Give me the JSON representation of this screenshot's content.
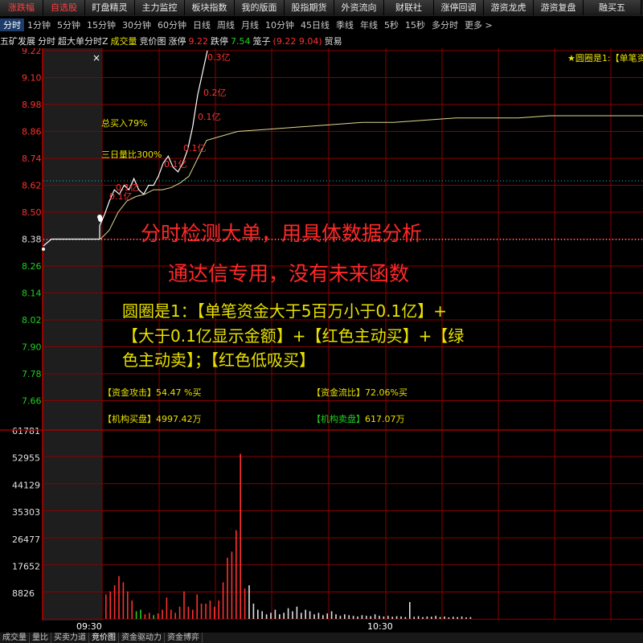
{
  "top_tabs": [
    {
      "label": "涨跌幅",
      "active": true,
      "w": 54
    },
    {
      "label": "自选股",
      "active": true,
      "w": 52
    },
    {
      "label": "盯盘精灵",
      "w": 62
    },
    {
      "label": "主力监控",
      "w": 62
    },
    {
      "label": "板块指数",
      "w": 62
    },
    {
      "label": "我的版面",
      "w": 62
    },
    {
      "label": "股指期货",
      "w": 62
    },
    {
      "label": "外资流向",
      "w": 62
    },
    {
      "label": "财联社",
      "w": 62
    },
    {
      "label": "涨停回调",
      "w": 62
    },
    {
      "label": "游资龙虎",
      "w": 62
    },
    {
      "label": "游资复盘",
      "w": 62
    },
    {
      "label": "融买五",
      "w": 72
    }
  ],
  "periods": [
    "分时",
    "1分钟",
    "5分钟",
    "15分钟",
    "30分钟",
    "60分钟",
    "日线",
    "周线",
    "月线",
    "10分钟",
    "45日线",
    "季线",
    "年线",
    "5秒",
    "15秒",
    "多分时",
    "更多 >"
  ],
  "stock": {
    "name": "五矿发展",
    "mode": "分时",
    "indicator": "超大单分时Z",
    "vol_label": "成交量",
    "pricechart_label": "竞价图",
    "limit_up_label": "涨停",
    "limit_up": "9.22",
    "limit_down_label": "跌停",
    "limit_down": "7.54",
    "cage_label": "笼子",
    "cage_value": "(9.22 9.04)",
    "trade": "贸易"
  },
  "corner_label": "★圆圈是1:【单笔资",
  "close_symbol": "×",
  "price_axis": [
    "9.22",
    "9.10",
    "8.98",
    "8.86",
    "8.74",
    "8.62",
    "8.50",
    "8.38",
    "8.26",
    "8.14",
    "8.02",
    "7.90",
    "7.78",
    "7.66"
  ],
  "volume_axis": [
    "61781",
    "52955",
    "44129",
    "35303",
    "26477",
    "17652",
    "8826"
  ],
  "time_labels": [
    "09:30",
    "10:30"
  ],
  "annotations": {
    "total_buy": "总买入79%",
    "three_day_ratio": "三日量比300%",
    "big_orders": [
      "0.3亿",
      "0.2亿",
      "0.1亿",
      "0.1亿",
      "0.1亿",
      "0.1亿",
      "0.1亿"
    ]
  },
  "overlay": {
    "line1": "分时检测大单，用具体数据分析",
    "line2": "通达信专用，没有未来函数",
    "desc": [
      "圆圈是1：【单笔资金大于5百万小于0.1亿】+",
      "【大于0.1亿显示金额】+【红色主动买】+【绿",
      "色主动卖】；【红色低吸买】"
    ]
  },
  "stats": {
    "attack_label": "【资金攻击】",
    "attack_value": "54.47 %买",
    "flow_label": "【资金流比】",
    "flow_value": "72.06%买",
    "inst_buy_label": "【机构买盘】",
    "inst_buy_value": "4997.42万",
    "inst_sell_label": "【机构卖盘】",
    "inst_sell_value": "617.07万"
  },
  "bottom_tabs": [
    "成交量",
    "量比",
    "买卖力道",
    "竞价图",
    "资金驱动力",
    "资金博弈"
  ],
  "colors": {
    "up": "#ff3030",
    "down": "#20d020",
    "accent": "#e8e000",
    "grid": "#8a0000"
  },
  "chart_data": {
    "type": "line",
    "x_labels": [
      "09:30",
      "10:30"
    ],
    "ylim": [
      7.6,
      9.22
    ],
    "price_series": [
      8.35,
      8.38,
      8.38,
      8.38,
      8.38,
      8.38,
      8.38,
      8.38,
      8.44,
      8.49,
      8.55,
      8.6,
      8.58,
      8.62,
      8.6,
      8.65,
      8.6,
      8.58,
      8.62,
      8.62,
      8.66,
      8.72,
      8.75,
      8.7,
      8.68,
      8.72,
      8.78,
      8.88,
      9.02,
      9.12,
      9.22
    ],
    "avg_series": [
      8.38,
      8.42,
      8.5,
      8.55,
      8.57,
      8.58,
      8.6,
      8.6,
      8.61,
      8.63,
      8.66,
      8.74,
      8.82,
      8.86,
      8.87,
      8.88,
      8.89,
      8.9,
      8.9,
      8.91,
      8.92,
      8.92,
      8.92,
      8.93,
      8.93,
      8.93,
      8.93
    ],
    "volume_ylim": [
      0,
      61781
    ],
    "volume_bars": [
      {
        "v": 8000,
        "c": "up"
      },
      {
        "v": 9000,
        "c": "up"
      },
      {
        "v": 11000,
        "c": "up"
      },
      {
        "v": 14000,
        "c": "up"
      },
      {
        "v": 12000,
        "c": "up"
      },
      {
        "v": 9000,
        "c": "up"
      },
      {
        "v": 6000,
        "c": "up"
      },
      {
        "v": 2500,
        "c": "down"
      },
      {
        "v": 3000,
        "c": "down"
      },
      {
        "v": 1500,
        "c": "up"
      },
      {
        "v": 2000,
        "c": "up"
      },
      {
        "v": 1200,
        "c": "down"
      },
      {
        "v": 1800,
        "c": "up"
      },
      {
        "v": 3000,
        "c": "up"
      },
      {
        "v": 7000,
        "c": "up"
      },
      {
        "v": 3000,
        "c": "up"
      },
      {
        "v": 2000,
        "c": "up"
      },
      {
        "v": 4000,
        "c": "up"
      },
      {
        "v": 9000,
        "c": "up"
      },
      {
        "v": 4000,
        "c": "up"
      },
      {
        "v": 3000,
        "c": "up"
      },
      {
        "v": 8000,
        "c": "up"
      },
      {
        "v": 5000,
        "c": "up"
      },
      {
        "v": 5000,
        "c": "up"
      },
      {
        "v": 6000,
        "c": "up"
      },
      {
        "v": 4000,
        "c": "up"
      },
      {
        "v": 6000,
        "c": "up"
      },
      {
        "v": 12000,
        "c": "up"
      },
      {
        "v": 20000,
        "c": "up"
      },
      {
        "v": 22000,
        "c": "up"
      },
      {
        "v": 29000,
        "c": "up"
      },
      {
        "v": 54000,
        "c": "up"
      },
      {
        "v": 10000,
        "c": "up"
      },
      {
        "v": 11000,
        "c": "up"
      },
      {
        "v": 5000,
        "c": "up"
      },
      {
        "v": 3000,
        "c": "up"
      },
      {
        "v": 2500,
        "c": "up"
      },
      {
        "v": 1500,
        "c": "up"
      },
      {
        "v": 2000,
        "c": "up"
      },
      {
        "v": 3000,
        "c": "up"
      },
      {
        "v": 1500,
        "c": "up"
      },
      {
        "v": 2000,
        "c": "up"
      },
      {
        "v": 3500,
        "c": "up"
      },
      {
        "v": 2500,
        "c": "up"
      },
      {
        "v": 4000,
        "c": "up"
      },
      {
        "v": 2000,
        "c": "down"
      },
      {
        "v": 3000,
        "c": "up"
      },
      {
        "v": 2500,
        "c": "up"
      },
      {
        "v": 1500,
        "c": "up"
      },
      {
        "v": 2000,
        "c": "up"
      },
      {
        "v": 1200,
        "c": "down"
      },
      {
        "v": 1800,
        "c": "up"
      },
      {
        "v": 2500,
        "c": "up"
      },
      {
        "v": 1500,
        "c": "up"
      },
      {
        "v": 1000,
        "c": "up"
      },
      {
        "v": 1500,
        "c": "up"
      },
      {
        "v": 1200,
        "c": "up"
      },
      {
        "v": 1000,
        "c": "up"
      },
      {
        "v": 800,
        "c": "up"
      },
      {
        "v": 1200,
        "c": "up"
      },
      {
        "v": 1000,
        "c": "up"
      },
      {
        "v": 900,
        "c": "up"
      },
      {
        "v": 1500,
        "c": "up"
      },
      {
        "v": 1000,
        "c": "up"
      },
      {
        "v": 800,
        "c": "up"
      },
      {
        "v": 1000,
        "c": "up"
      },
      {
        "v": 700,
        "c": "up"
      },
      {
        "v": 900,
        "c": "up"
      },
      {
        "v": 800,
        "c": "up"
      },
      {
        "v": 600,
        "c": "up"
      },
      {
        "v": 5500,
        "c": "up"
      },
      {
        "v": 700,
        "c": "up"
      },
      {
        "v": 900,
        "c": "up"
      },
      {
        "v": 600,
        "c": "up"
      },
      {
        "v": 800,
        "c": "up"
      },
      {
        "v": 700,
        "c": "up"
      },
      {
        "v": 1000,
        "c": "up"
      },
      {
        "v": 600,
        "c": "up"
      },
      {
        "v": 800,
        "c": "up"
      },
      {
        "v": 500,
        "c": "up"
      },
      {
        "v": 700,
        "c": "up"
      },
      {
        "v": 600,
        "c": "up"
      },
      {
        "v": 800,
        "c": "up"
      },
      {
        "v": 500,
        "c": "up"
      },
      {
        "v": 600,
        "c": "up"
      }
    ]
  }
}
